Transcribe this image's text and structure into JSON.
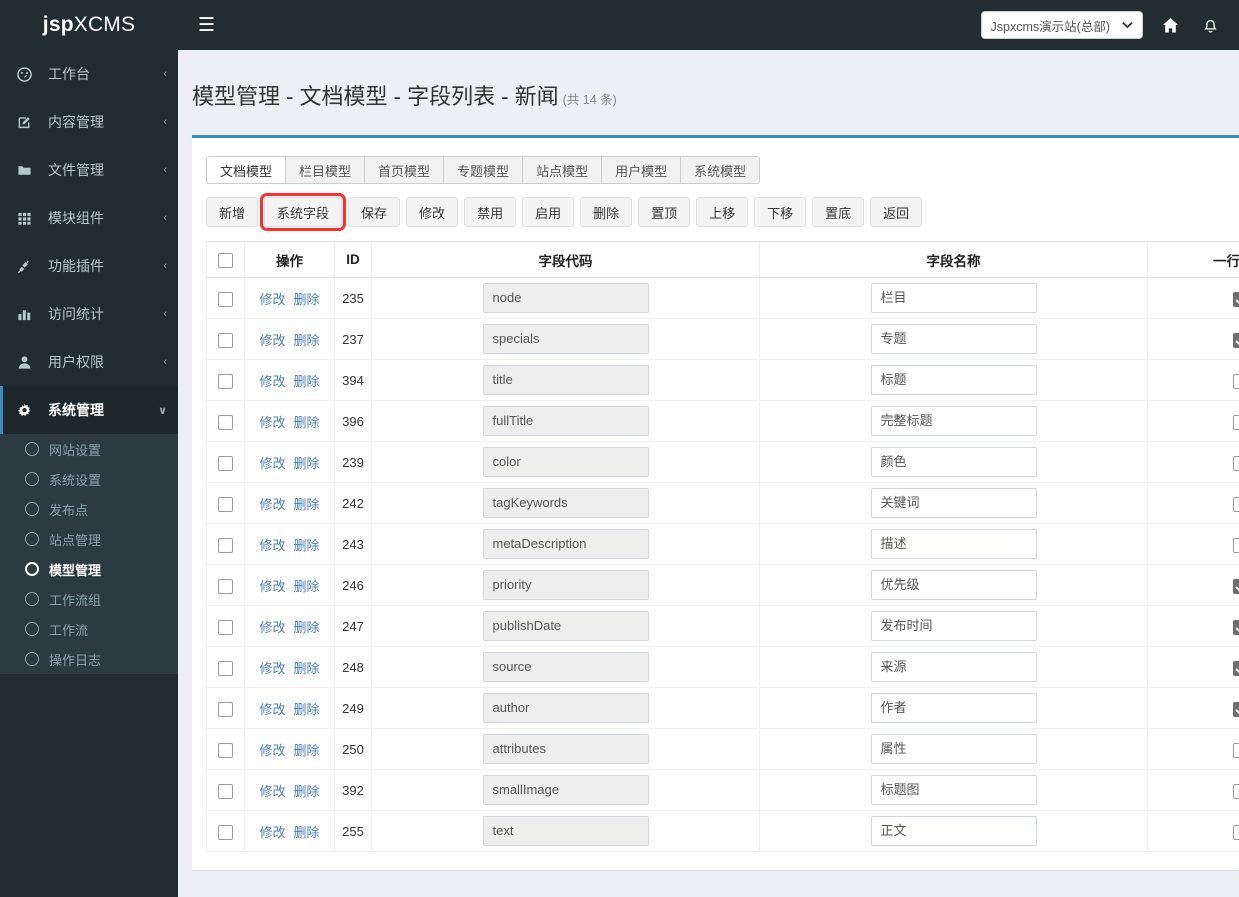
{
  "brand": {
    "bold": "jsp",
    "light": "XCMS"
  },
  "header": {
    "hamburger": "☰",
    "site_select_value": "Jspxcms演示站(总部)",
    "site_select_caret": "⌄",
    "home_icon": "home-icon",
    "bell_icon": "bell-icon"
  },
  "sidebar": {
    "items": [
      {
        "label": "工作台",
        "icon": "dashboard-icon",
        "arrow": "‹",
        "active": false
      },
      {
        "label": "内容管理",
        "icon": "edit-icon",
        "arrow": "‹",
        "active": false
      },
      {
        "label": "文件管理",
        "icon": "folder-icon",
        "arrow": "‹",
        "active": false
      },
      {
        "label": "模块组件",
        "icon": "grid-icon",
        "arrow": "‹",
        "active": false
      },
      {
        "label": "功能插件",
        "icon": "plug-icon",
        "arrow": "‹",
        "active": false
      },
      {
        "label": "访问统计",
        "icon": "chart-icon",
        "arrow": "‹",
        "active": false
      },
      {
        "label": "用户权限",
        "icon": "user-icon",
        "arrow": "‹",
        "active": false
      },
      {
        "label": "系统管理",
        "icon": "gear-icon",
        "arrow": "∨",
        "active": true
      }
    ],
    "submenu": [
      {
        "label": "网站设置",
        "active": false
      },
      {
        "label": "系统设置",
        "active": false
      },
      {
        "label": "发布点",
        "active": false
      },
      {
        "label": "站点管理",
        "active": false
      },
      {
        "label": "模型管理",
        "active": true
      },
      {
        "label": "工作流组",
        "active": false
      },
      {
        "label": "工作流",
        "active": false
      },
      {
        "label": "操作日志",
        "active": false
      }
    ]
  },
  "page": {
    "title": "模型管理 - 文档模型 - 字段列表 - 新闻",
    "count": "(共 14 条)"
  },
  "tabs": [
    {
      "label": "文档模型",
      "active": true
    },
    {
      "label": "栏目模型",
      "active": false
    },
    {
      "label": "首页模型",
      "active": false
    },
    {
      "label": "专题模型",
      "active": false
    },
    {
      "label": "站点模型",
      "active": false
    },
    {
      "label": "用户模型",
      "active": false
    },
    {
      "label": "系统模型",
      "active": false
    }
  ],
  "toolbar": [
    {
      "label": "新增",
      "name": "add-button",
      "highlight": false
    },
    {
      "label": "系统字段",
      "name": "system-field-button",
      "highlight": true
    },
    {
      "label": "保存",
      "name": "save-button",
      "highlight": false
    },
    {
      "label": "修改",
      "name": "edit-button",
      "highlight": false
    },
    {
      "label": "禁用",
      "name": "disable-button",
      "highlight": false
    },
    {
      "label": "启用",
      "name": "enable-button",
      "highlight": false
    },
    {
      "label": "删除",
      "name": "delete-button",
      "highlight": false
    },
    {
      "label": "置顶",
      "name": "move-top-button",
      "highlight": false
    },
    {
      "label": "上移",
      "name": "move-up-button",
      "highlight": false
    },
    {
      "label": "下移",
      "name": "move-down-button",
      "highlight": false
    },
    {
      "label": "置底",
      "name": "move-bottom-button",
      "highlight": false
    },
    {
      "label": "返回",
      "name": "back-button",
      "highlight": false
    }
  ],
  "table": {
    "headers": {
      "select_all": "",
      "operation": "操作",
      "id": "ID",
      "code": "字段代码",
      "name": "字段名称",
      "two_col": "一行两列"
    },
    "row_actions": {
      "edit": "修改",
      "delete": "删除"
    },
    "rows": [
      {
        "id": "235",
        "code": "node",
        "name": "栏目",
        "two_col": true,
        "selected": false
      },
      {
        "id": "237",
        "code": "specials",
        "name": "专题",
        "two_col": true,
        "selected": false
      },
      {
        "id": "394",
        "code": "title",
        "name": "标题",
        "two_col": false,
        "selected": false
      },
      {
        "id": "396",
        "code": "fullTitle",
        "name": "完整标题",
        "two_col": false,
        "selected": false
      },
      {
        "id": "239",
        "code": "color",
        "name": "颜色",
        "two_col": false,
        "selected": false
      },
      {
        "id": "242",
        "code": "tagKeywords",
        "name": "关键词",
        "two_col": false,
        "selected": false
      },
      {
        "id": "243",
        "code": "metaDescription",
        "name": "描述",
        "two_col": false,
        "selected": false
      },
      {
        "id": "246",
        "code": "priority",
        "name": "优先级",
        "two_col": true,
        "selected": false
      },
      {
        "id": "247",
        "code": "publishDate",
        "name": "发布时间",
        "two_col": true,
        "selected": false
      },
      {
        "id": "248",
        "code": "source",
        "name": "来源",
        "two_col": true,
        "selected": false
      },
      {
        "id": "249",
        "code": "author",
        "name": "作者",
        "two_col": true,
        "selected": false
      },
      {
        "id": "250",
        "code": "attributes",
        "name": "属性",
        "two_col": false,
        "selected": false
      },
      {
        "id": "392",
        "code": "smallImage",
        "name": "标题图",
        "two_col": false,
        "selected": false
      },
      {
        "id": "255",
        "code": "text",
        "name": "正文",
        "two_col": false,
        "selected": false
      }
    ]
  },
  "colors": {
    "sidebar_bg": "#222d32",
    "submenu_bg": "#2c3b41",
    "accent": "#3c8dbc",
    "content_bg": "#ecf0f5",
    "highlight": "#ff2d2d",
    "link": "#4a7ebb"
  }
}
